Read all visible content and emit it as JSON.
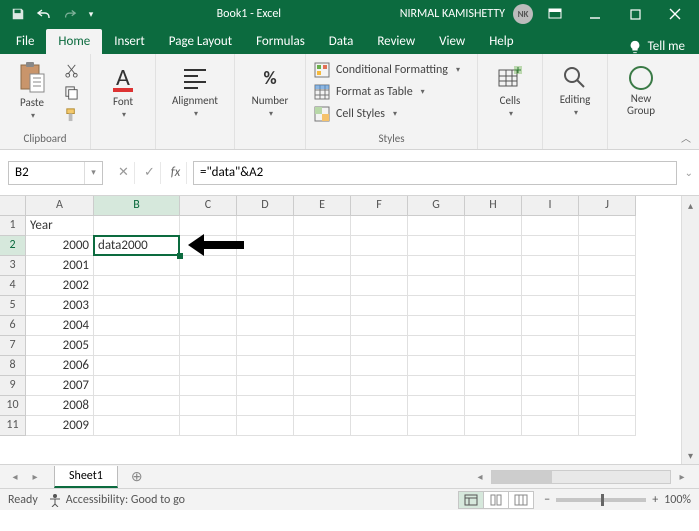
{
  "title": "Book1 - Excel",
  "user": "NIRMAL KAMISHETTY",
  "user_initials": "NK",
  "menu": {
    "file": "File",
    "home": "Home",
    "insert": "Insert",
    "page_layout": "Page Layout",
    "formulas": "Formulas",
    "data": "Data",
    "review": "Review",
    "view": "View",
    "help": "Help",
    "tell_me": "Tell me"
  },
  "ribbon": {
    "clipboard": {
      "paste": "Paste",
      "label": "Clipboard"
    },
    "font": {
      "btn": "Font"
    },
    "alignment": {
      "btn": "Alignment"
    },
    "number": {
      "btn": "Number"
    },
    "styles": {
      "cond": "Conditional Formatting",
      "table": "Format as Table",
      "cell": "Cell Styles",
      "label": "Styles"
    },
    "cells": {
      "btn": "Cells"
    },
    "editing": {
      "btn": "Editing"
    },
    "newgroup": {
      "btn": "New Group"
    }
  },
  "namebox": "B2",
  "formula": "=\"data\"&A2",
  "columns": [
    "A",
    "B",
    "C",
    "D",
    "E",
    "F",
    "G",
    "H",
    "I",
    "J"
  ],
  "rows": [
    "1",
    "2",
    "3",
    "4",
    "5",
    "6",
    "7",
    "8",
    "9",
    "10",
    "11"
  ],
  "cells": {
    "A1": "Year",
    "A2": "2000",
    "A3": "2001",
    "A4": "2002",
    "A5": "2003",
    "A6": "2004",
    "A7": "2005",
    "A8": "2006",
    "A9": "2007",
    "A10": "2008",
    "A11": "2009",
    "B2": "data2000"
  },
  "sheet": "Sheet1",
  "status": {
    "ready": "Ready",
    "access": "Accessibility: Good to go",
    "zoom": "100%"
  }
}
